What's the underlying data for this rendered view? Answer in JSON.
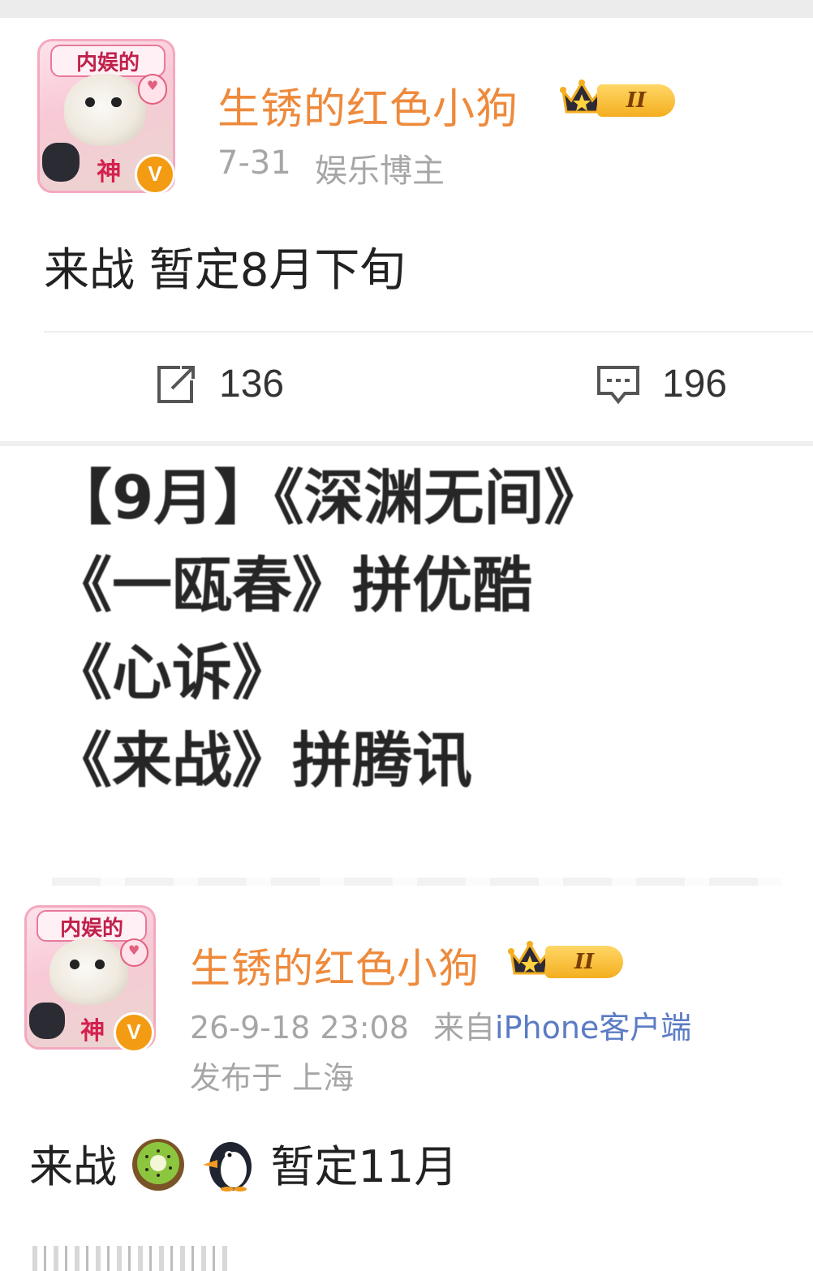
{
  "post1": {
    "username": "生锈的红色小狗",
    "vip_level": "II",
    "avatar_caption_top": "内娱的",
    "avatar_caption_bottom": "神",
    "verify_mark": "V",
    "date": "7-31",
    "identity": "娱乐博主",
    "content": "来战 暂定8月下旬",
    "reposts": "136",
    "comments": "196"
  },
  "image_text": {
    "lines": [
      "【9月】《深渊无间》",
      "《一瓯春》拼优酷",
      "《心诉》",
      "《来战》拼腾讯"
    ]
  },
  "post2": {
    "username": "生锈的红色小狗",
    "vip_level": "II",
    "avatar_caption_top": "内娱的",
    "avatar_caption_bottom": "神",
    "verify_mark": "V",
    "datetime": "26-9-18 23:08",
    "source_prefix": "来自",
    "source_app": "iPhone客户端",
    "location": "发布于 上海",
    "content_prefix": "来战",
    "content_suffix": "暂定11月",
    "emojis": [
      "kiwi-emoji",
      "penguin-emoji"
    ]
  },
  "colors": {
    "username": "#ee8a3c",
    "meta_gray": "#a6a6a6",
    "link_blue": "#5b7cc4",
    "vip_gold": "#f4ae1f",
    "verify_orange": "#f39b12"
  }
}
